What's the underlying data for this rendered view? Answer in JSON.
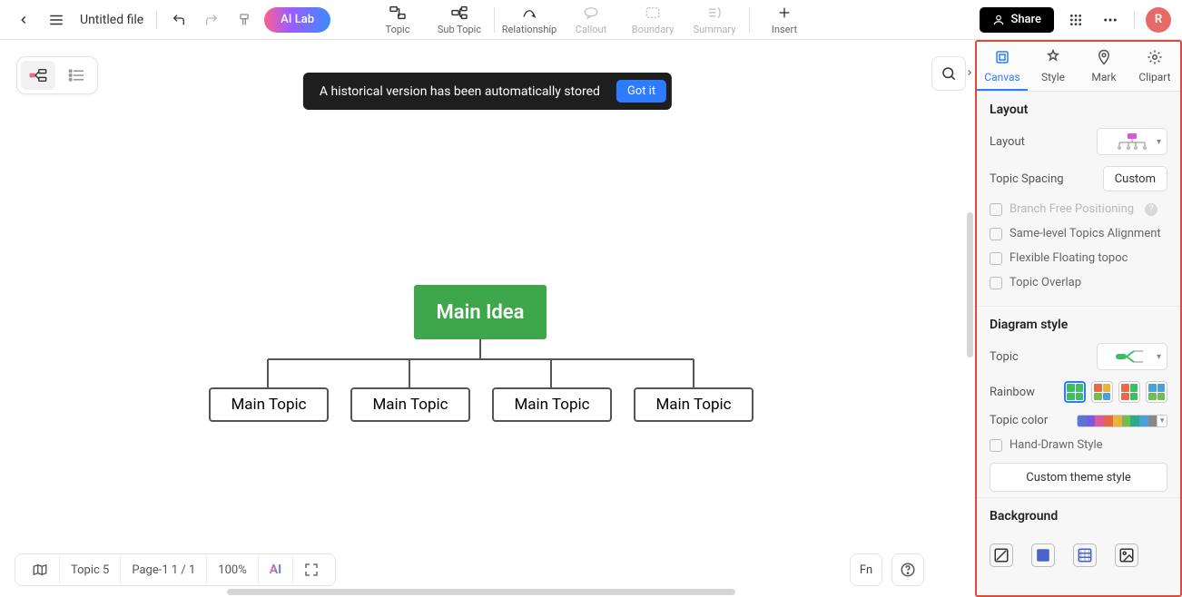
{
  "topbar": {
    "file_title": "Untitled file",
    "ai_lab": "AI Lab",
    "tools": {
      "topic": "Topic",
      "subtopic": "Sub Topic",
      "relationship": "Relationship",
      "callout": "Callout",
      "boundary": "Boundary",
      "summary": "Summary",
      "insert": "Insert"
    },
    "share": "Share",
    "avatar_initial": "R"
  },
  "toast": {
    "message": "A historical version has been automatically stored",
    "button": "Got it"
  },
  "mindmap": {
    "root": "Main Idea",
    "children": [
      "Main Topic",
      "Main Topic",
      "Main Topic",
      "Main Topic"
    ]
  },
  "bottombar": {
    "topic_count": "Topic 5",
    "page": "Page-1  1 / 1",
    "zoom": "100%",
    "ai": "AI",
    "fn": "Fn"
  },
  "right_panel": {
    "tabs": {
      "canvas": "Canvas",
      "style": "Style",
      "mark": "Mark",
      "clipart": "Clipart"
    },
    "layout": {
      "heading": "Layout",
      "layout_label": "Layout",
      "spacing_label": "Topic Spacing",
      "spacing_value": "Custom",
      "branch_free": "Branch Free Positioning",
      "same_level": "Same-level Topics Alignment",
      "flex_float": "Flexible Floating topoc",
      "overlap": "Topic Overlap"
    },
    "diagram": {
      "heading": "Diagram style",
      "topic_label": "Topic",
      "rainbow_label": "Rainbow",
      "topic_color_label": "Topic color",
      "hand_drawn": "Hand-Drawn Style",
      "custom_theme": "Custom theme style",
      "topic_colors": [
        "#5b74d8",
        "#7a5bd8",
        "#d85ba0",
        "#e26a4a",
        "#e8b23b",
        "#6fbf4f",
        "#2fa98c",
        "#4aa0d8",
        "#888888"
      ]
    },
    "background": {
      "heading": "Background"
    }
  }
}
